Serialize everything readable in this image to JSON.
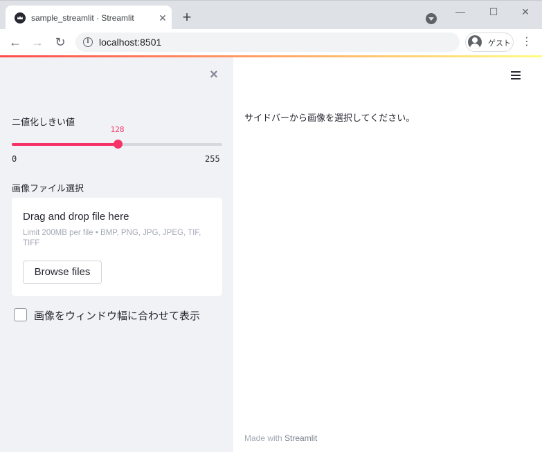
{
  "browser": {
    "tab_title": "sample_streamlit · Streamlit",
    "tab_close": "✕",
    "new_tab": "+",
    "url": "localhost:8501",
    "profile_label": "ゲスト",
    "back_glyph": "←",
    "forward_glyph": "→",
    "reload_glyph": "↻",
    "menu_glyph": "⋮",
    "minimize_glyph": "—",
    "maximize_glyph": "☐",
    "close_glyph": "✕",
    "info_glyph": "i"
  },
  "sidebar": {
    "close_glyph": "×",
    "slider": {
      "label": "二値化しきい値",
      "value": 128,
      "min": 0,
      "max": 255,
      "min_label": "0",
      "max_label": "255",
      "value_label": "128",
      "accent_color": "#f63366"
    },
    "uploader": {
      "label": "画像ファイル選択",
      "drop_title": "Drag and drop file here",
      "limit_text": "Limit 200MB per file • BMP, PNG, JPG, JPEG, TIF, TIFF",
      "browse_label": "Browse files"
    },
    "checkbox": {
      "label": "画像をウィンドウ幅に合わせて表示",
      "checked": false
    }
  },
  "main": {
    "message": "サイドバーから画像を選択してください。",
    "footer_prefix": "Made with ",
    "footer_link": "Streamlit"
  },
  "icons": {
    "favicon": "streamlit-crown-icon",
    "menu": "hamburger-menu-icon",
    "media": "media-control-icon"
  }
}
